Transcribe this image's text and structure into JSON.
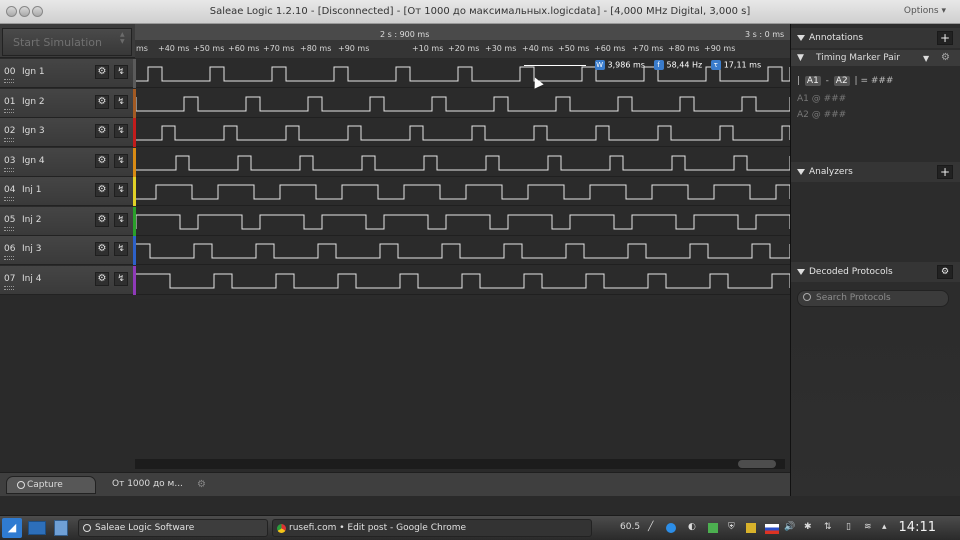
{
  "window": {
    "title": "Saleae Logic 1.2.10 - [Disconnected] - [От 1000 до максимальных.logicdata] - [4,000 MHz Digital, 3,000 s]",
    "options_label": "Options ▾"
  },
  "toolbar": {
    "start_simulation_label": "Start Simulation"
  },
  "ruler": {
    "major_left": "2 s : 900 ms",
    "major_right": "3 s : 0 ms",
    "ticks": [
      "ms",
      "+40 ms",
      "+50 ms",
      "+60 ms",
      "+70 ms",
      "+80 ms",
      "+90 ms",
      "+10 ms",
      "+20 ms",
      "+30 ms",
      "+40 ms",
      "+50 ms",
      "+60 ms",
      "+70 ms",
      "+80 ms",
      "+90 ms"
    ]
  },
  "channels": [
    {
      "num": "00",
      "name": "Ign 1",
      "color": "#5b5b5b"
    },
    {
      "num": "01",
      "name": "Ign 2",
      "color": "#a35a23"
    },
    {
      "num": "02",
      "name": "Ign 3",
      "color": "#c21c1c"
    },
    {
      "num": "03",
      "name": "Ign 4",
      "color": "#d98b14"
    },
    {
      "num": "04",
      "name": "Inj 1",
      "color": "#e1d227"
    },
    {
      "num": "05",
      "name": "Inj 2",
      "color": "#2aa02a"
    },
    {
      "num": "06",
      "name": "Inj 3",
      "color": "#2d61c9"
    },
    {
      "num": "07",
      "name": "Inj 4",
      "color": "#8f3ab8"
    }
  ],
  "measurement": {
    "width": "3,986 ms",
    "freq": "58,44 Hz",
    "period": "17,11 ms",
    "w_badge": "W",
    "f_badge": "f",
    "t_badge": "τ"
  },
  "tabs": {
    "capture": "Capture",
    "file": "От 1000 до м..."
  },
  "panel": {
    "annotations": "Annotations",
    "timing_marker": "Timing Marker Pair",
    "formula_a1": "A1",
    "formula_a2": "A2",
    "formula_rest": "= ###",
    "a1_row": "A1  @  ###",
    "a2_row": "A2  @  ###",
    "analyzers": "Analyzers",
    "decoded": "Decoded Protocols",
    "search_placeholder": "Search Protocols"
  },
  "taskbar": {
    "app1": "Saleae Logic Software",
    "app2": "rusefi.com • Edit post - Google Chrome",
    "cpu": "60.5",
    "clock": "14:11"
  }
}
